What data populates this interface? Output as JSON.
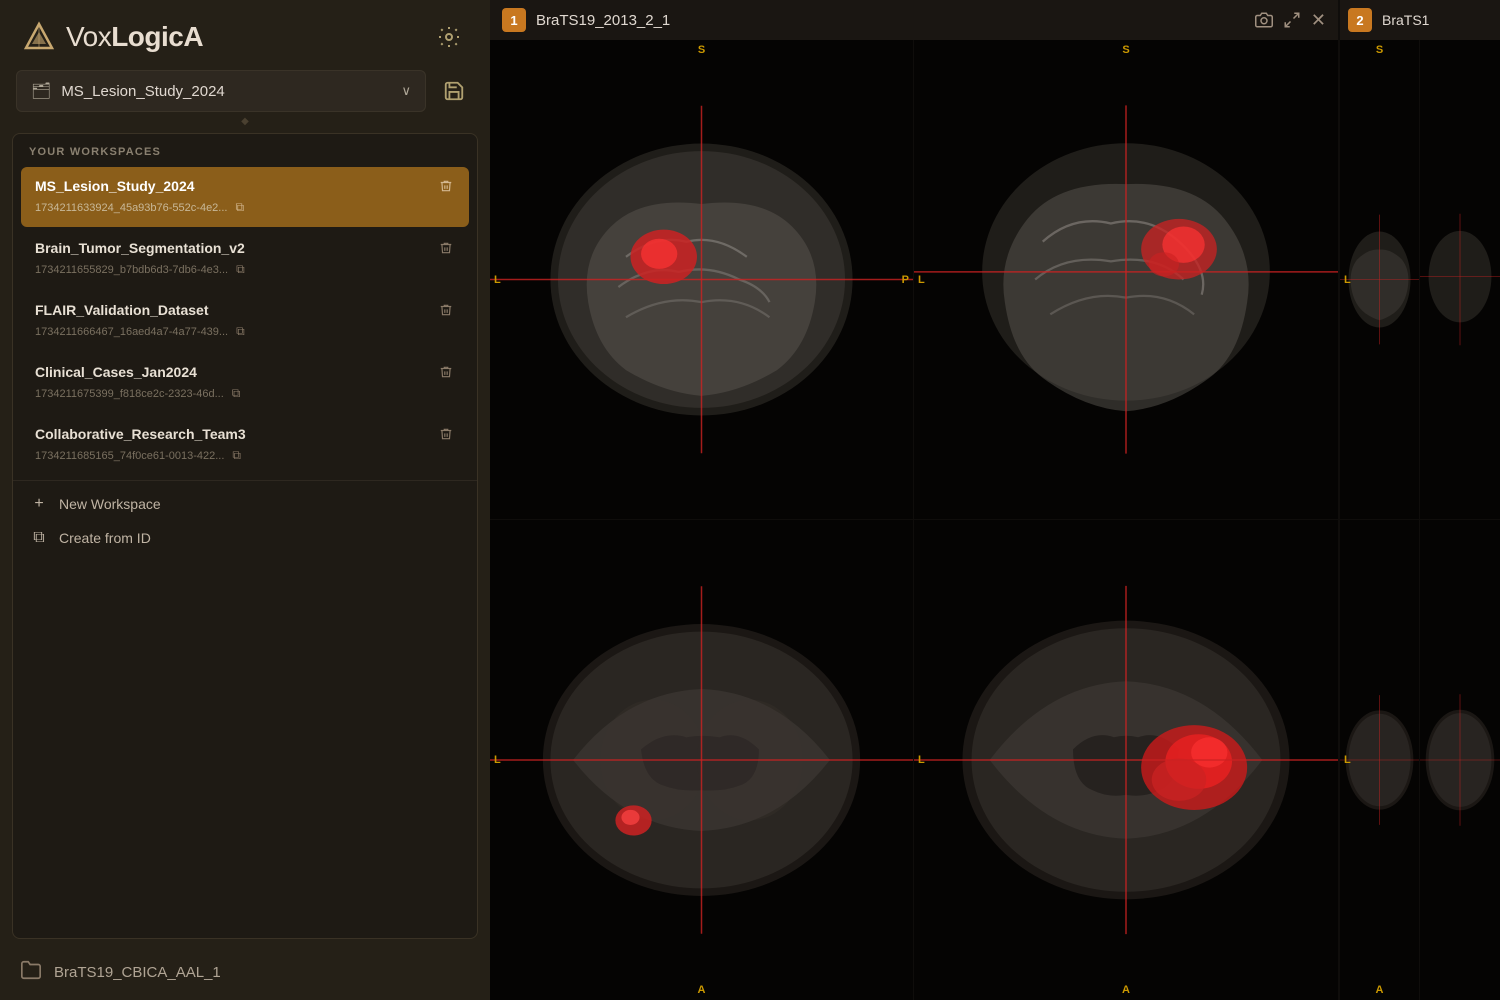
{
  "app": {
    "title": "VoxLogicA",
    "title_light": "Vox",
    "title_bold": "LogicA"
  },
  "toolbar": {
    "gear_label": "⚙",
    "save_label": "💾"
  },
  "workspace_selector": {
    "icon": "🗂",
    "current": "MS_Lesion_Study_2024",
    "chevron": "∨"
  },
  "workspaces_panel": {
    "header": "YOUR WORKSPACES",
    "items": [
      {
        "name": "MS_Lesion_Study_2024",
        "id": "1734211633924_45a93b76-552c-4e2...",
        "active": true
      },
      {
        "name": "Brain_Tumor_Segmentation_v2",
        "id": "1734211655829_b7bdb6d3-7db6-4e3...",
        "active": false
      },
      {
        "name": "FLAIR_Validation_Dataset",
        "id": "1734211666467_16aed4a7-4a77-439...",
        "active": false
      },
      {
        "name": "Clinical_Cases_Jan2024",
        "id": "1734211675399_f818ce2c-2323-46d...",
        "active": false
      },
      {
        "name": "Collaborative_Research_Team3",
        "id": "1734211685165_74f0ce61-0013-422...",
        "active": false
      }
    ],
    "new_workspace": "New Workspace",
    "create_from_id": "Create from ID"
  },
  "bottom_folder": {
    "name": "BraTS19_CBICA_AAL_1"
  },
  "viewers": [
    {
      "number": "1",
      "title": "BraTS19_2013_2_1",
      "controls": [
        "📷",
        "⛶",
        "✕"
      ]
    },
    {
      "number": "2",
      "title": "BraTS1"
    }
  ],
  "orientation_labels": {
    "top": "S",
    "bottom": "A",
    "left": "L",
    "right": "P"
  }
}
